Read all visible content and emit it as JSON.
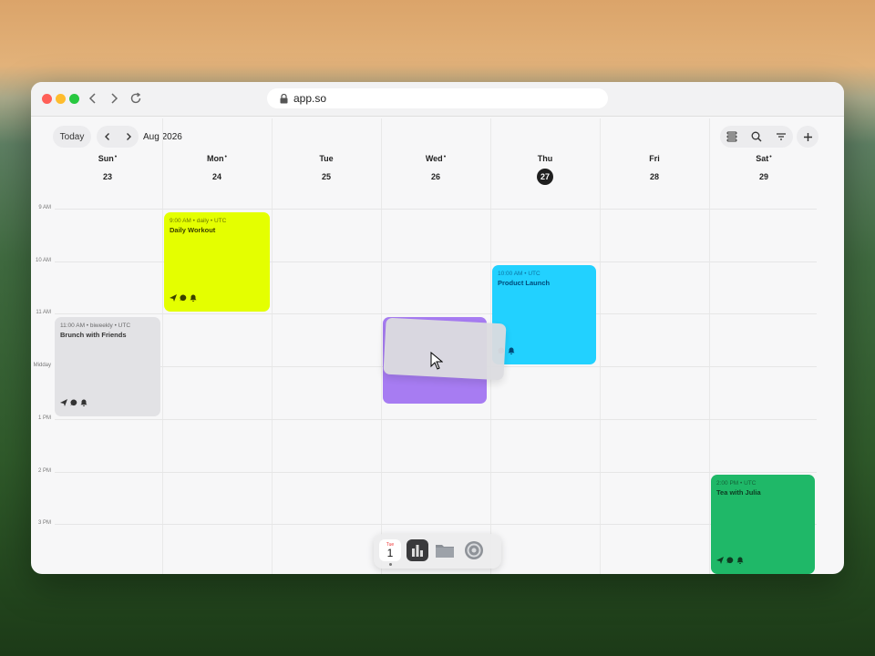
{
  "browser": {
    "url": "app.so"
  },
  "toolbar": {
    "today_label": "Today",
    "month_label": "Aug 2026"
  },
  "days": [
    {
      "name": "Sun",
      "num": "23",
      "dot": true,
      "today": false
    },
    {
      "name": "Mon",
      "num": "24",
      "dot": true,
      "today": false
    },
    {
      "name": "Tue",
      "num": "25",
      "dot": false,
      "today": false
    },
    {
      "name": "Wed",
      "num": "26",
      "dot": true,
      "today": false
    },
    {
      "name": "Thu",
      "num": "27",
      "dot": false,
      "today": true
    },
    {
      "name": "Fri",
      "num": "28",
      "dot": false,
      "today": false
    },
    {
      "name": "Sat",
      "num": "29",
      "dot": true,
      "today": false
    }
  ],
  "hours": [
    "9 AM",
    "10 AM",
    "11 AM",
    "Midday",
    "1 PM",
    "2 PM",
    "3 PM"
  ],
  "events": [
    {
      "meta": "9:00 AM • daily • UTC",
      "title": "Daily Workout",
      "color": "#e4ff00",
      "text_color": "#3b4000"
    },
    {
      "meta": "10:00 AM • UTC",
      "title": "Product Launch",
      "color": "#22d1ff",
      "text_color": "#004a7a"
    },
    {
      "meta": "11:00 AM • biweekly • UTC",
      "title": "Brunch with Friends",
      "color": "#e2e2e5",
      "text_color": "#333333"
    },
    {
      "meta": "2:00 PM • UTC",
      "title": "Tea with Julia",
      "color": "#1fb868",
      "text_color": "#0d3b21"
    }
  ],
  "dock": {
    "calendar_day_label": "Tue",
    "calendar_day_num": "1"
  },
  "colors": {
    "accent_dark": "#1f1f1f",
    "dragged_event": "#a77cf2"
  }
}
